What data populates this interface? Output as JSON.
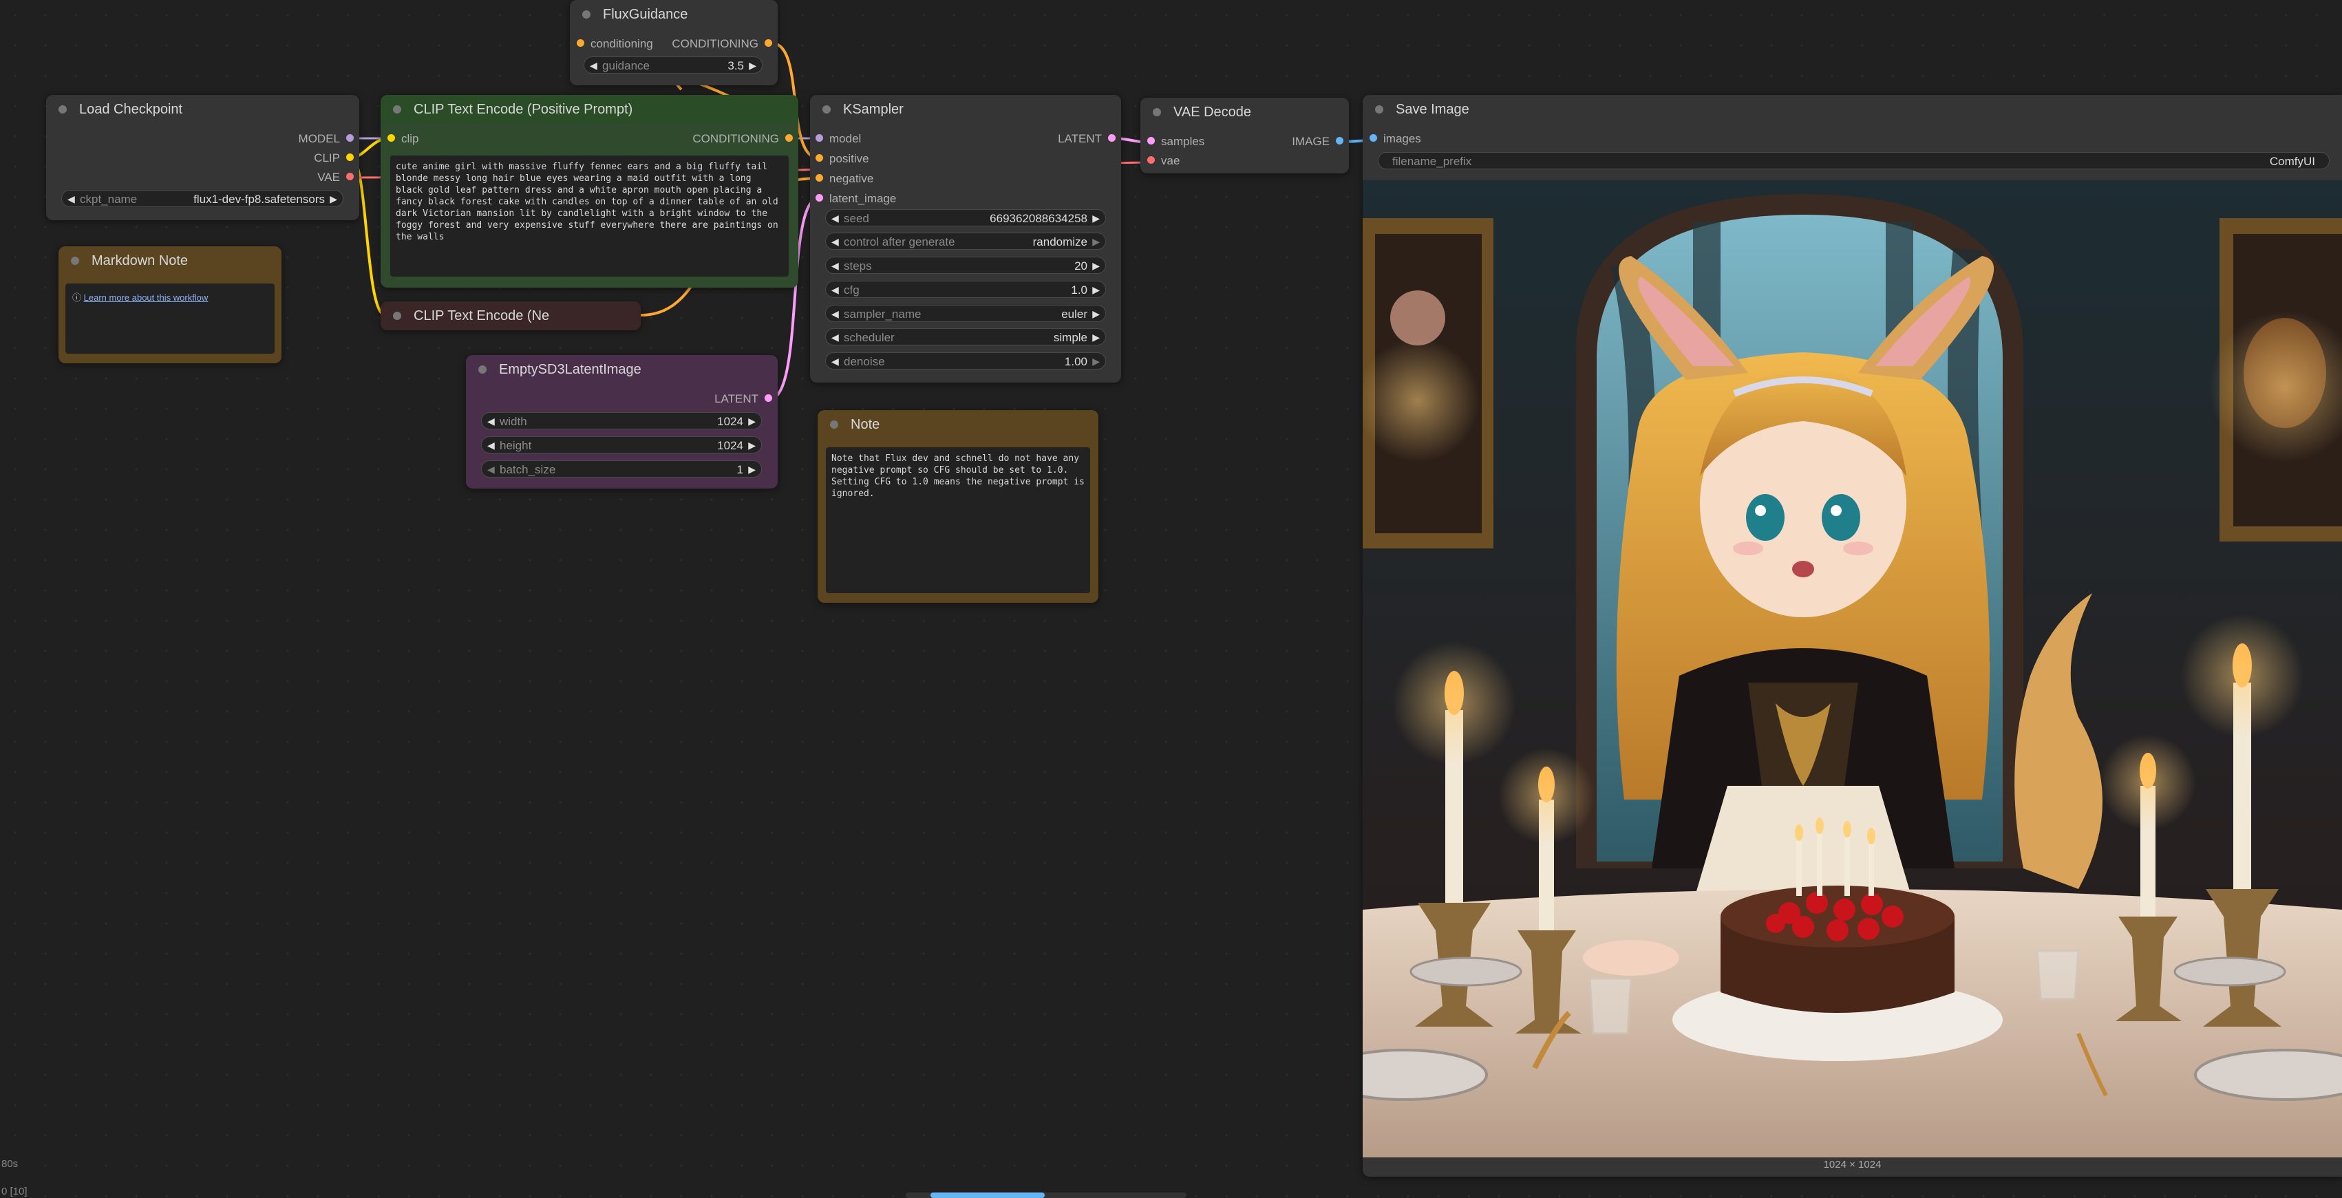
{
  "colors": {
    "canvas_bg": "#202020",
    "node_bg": "#353535",
    "positive_node": "#2f4a2c",
    "negative_node": "#3a2626",
    "latent_node": "#4a2f4a",
    "note_node": "#5a4520",
    "model_pin": "#b39ddb",
    "clip_pin": "#ffd500",
    "vae_pin": "#ff6e6e",
    "conditioning_pin": "#ffa931",
    "latent_pin": "#ff9cf9",
    "image_pin": "#64b5f6"
  },
  "nodes": {
    "flux_guidance": {
      "title": "FluxGuidance",
      "input_conditioning": "conditioning",
      "output_conditioning": "CONDITIONING",
      "guidance_label": "guidance",
      "guidance_value": "3.5"
    },
    "load_checkpoint": {
      "title": "Load Checkpoint",
      "out_model": "MODEL",
      "out_clip": "CLIP",
      "out_vae": "VAE",
      "ckpt_label": "ckpt_name",
      "ckpt_value": "flux1-dev-fp8.safetensors"
    },
    "clip_positive": {
      "title": "CLIP Text Encode (Positive Prompt)",
      "input_clip": "clip",
      "output": "CONDITIONING",
      "text": "cute anime girl with massive fluffy fennec ears and a big fluffy tail blonde messy long hair blue eyes wearing a maid outfit with a long black gold leaf pattern dress and a white apron mouth open placing a fancy black forest cake with candles on top of a dinner table of an old dark Victorian mansion lit by candlelight with a bright window to the foggy forest and very expensive stuff everywhere there are paintings on the walls"
    },
    "clip_negative": {
      "title": "CLIP Text Encode (Ne"
    },
    "markdown_note": {
      "title": "Markdown Note",
      "link_icon": "info-icon",
      "link_text": "Learn more about this workflow"
    },
    "empty_latent": {
      "title": "EmptySD3LatentImage",
      "output": "LATENT",
      "width_label": "width",
      "width_value": "1024",
      "height_label": "height",
      "height_value": "1024",
      "batch_label": "batch_size",
      "batch_value": "1"
    },
    "ksampler": {
      "title": "KSampler",
      "in_model": "model",
      "in_positive": "positive",
      "in_negative": "negative",
      "in_latent": "latent_image",
      "output": "LATENT",
      "widgets": [
        {
          "label": "seed",
          "value": "669362088634258"
        },
        {
          "label": "control after generate",
          "value": "randomize"
        },
        {
          "label": "steps",
          "value": "20"
        },
        {
          "label": "cfg",
          "value": "1.0"
        },
        {
          "label": "sampler_name",
          "value": "euler"
        },
        {
          "label": "scheduler",
          "value": "simple"
        },
        {
          "label": "denoise",
          "value": "1.00"
        }
      ]
    },
    "note": {
      "title": "Note",
      "text": "Note that Flux dev and schnell do not have any negative prompt so CFG should be set to 1.0. Setting CFG to 1.0 means the negative prompt is ignored."
    },
    "vae_decode": {
      "title": "VAE Decode",
      "in_samples": "samples",
      "in_vae": "vae",
      "output": "IMAGE"
    },
    "save_image": {
      "title": "Save Image",
      "in_images": "images",
      "prefix_label": "filename_prefix",
      "prefix_value": "ComfyUI",
      "image_size": "1024 × 1024"
    }
  },
  "status": {
    "time": "80s",
    "coords": "0 [10]"
  }
}
